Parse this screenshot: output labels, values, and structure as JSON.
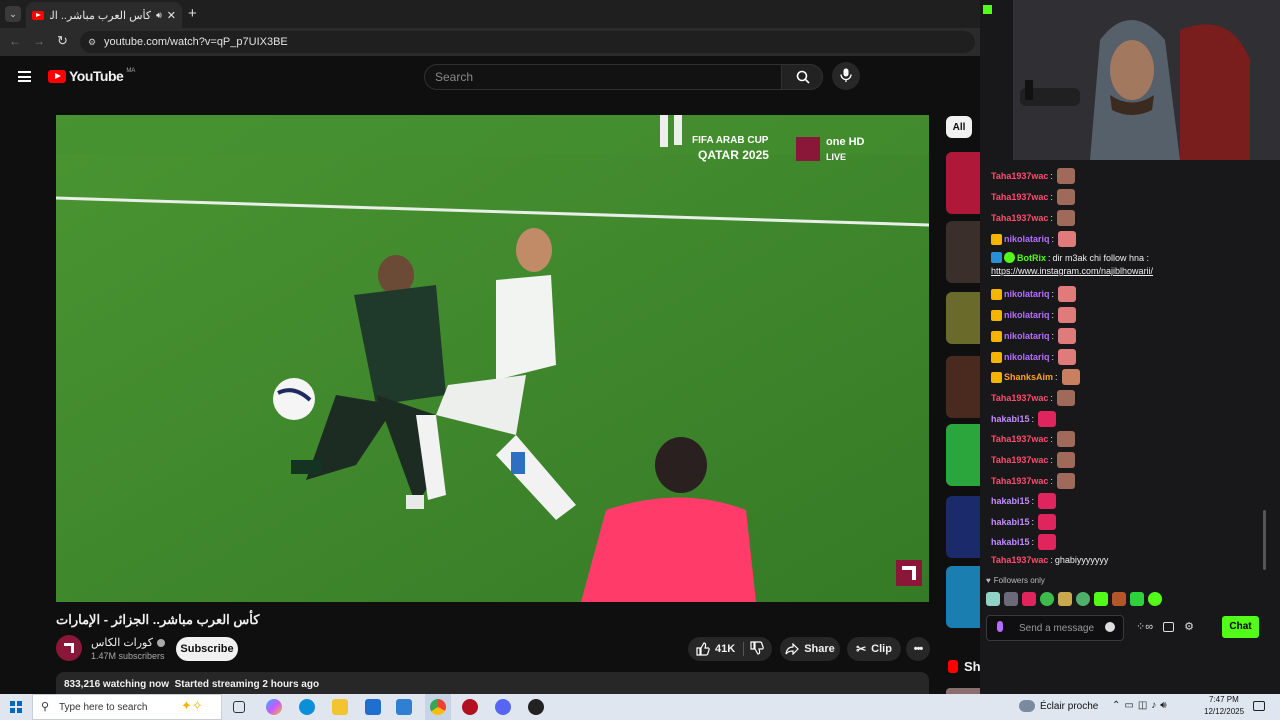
{
  "browser": {
    "tab_title": "كأس العرب مباشر.. الجزائر - الإ",
    "url": "youtube.com/watch?v=qP_p7UIX3BE"
  },
  "youtube": {
    "logo_text": "YouTube",
    "region": "MA",
    "search_placeholder": "Search",
    "overlay_event": "FIFA ARAB CUP",
    "overlay_event2": "QATAR 2025",
    "overlay_channel": "one HD",
    "overlay_live": "LIVE",
    "title": "كأس العرب مباشر.. الجزائر - الإمارات",
    "channel_name": "كورات الكاس",
    "subscribers": "1.47M subscribers",
    "subscribe_label": "Subscribe",
    "likes": "41K",
    "share_label": "Share",
    "clip_label": "Clip",
    "stats": "833,216 watching now  Started streaming 2 hours ago",
    "filter_chip": "All",
    "shorts_label": "Shorts"
  },
  "chat": {
    "messages": [
      {
        "user": "Taha1937wac",
        "text": "",
        "color": "#ff4b6e"
      },
      {
        "user": "Taha1937wac",
        "text": "",
        "color": "#ff4b6e"
      },
      {
        "user": "Taha1937wac",
        "text": "",
        "color": "#ff4b6e"
      },
      {
        "user": "nikolatariq",
        "text": "",
        "color": "#b76bff"
      },
      {
        "user": "BotRix",
        "text": "dir m3ak chi follow hna :",
        "color": "#53fc18"
      },
      {
        "user": "",
        "text": "https://www.instagram.com/najiblhowarii/",
        "color": "#ffffff"
      },
      {
        "user": "nikolatariq",
        "text": "",
        "color": "#b76bff"
      },
      {
        "user": "nikolatariq",
        "text": "",
        "color": "#b76bff"
      },
      {
        "user": "nikolatariq",
        "text": "",
        "color": "#b76bff"
      },
      {
        "user": "nikolatariq",
        "text": "",
        "color": "#b76bff"
      },
      {
        "user": "ShanksAim",
        "text": "",
        "color": "#ffa020"
      },
      {
        "user": "Taha1937wac",
        "text": "",
        "color": "#ff4b6e"
      },
      {
        "user": "hakabi15",
        "text": "",
        "color": "#c48bff"
      },
      {
        "user": "Taha1937wac",
        "text": "",
        "color": "#ff4b6e"
      },
      {
        "user": "Taha1937wac",
        "text": "",
        "color": "#ff4b6e"
      },
      {
        "user": "Taha1937wac",
        "text": "",
        "color": "#ff4b6e"
      },
      {
        "user": "hakabi15",
        "text": "",
        "color": "#c48bff"
      },
      {
        "user": "hakabi15",
        "text": "",
        "color": "#c48bff"
      },
      {
        "user": "hakabi15",
        "text": "",
        "color": "#c48bff"
      },
      {
        "user": "Taha1937wac",
        "text": "ghabiyyyyyyy",
        "color": "#ff4b6e"
      }
    ],
    "followers_only": "Followers only",
    "input_placeholder": "Send a message",
    "chat_button": "Chat"
  },
  "taskbar": {
    "search_placeholder": "Type here to search",
    "weather": "Éclair proche",
    "time": "7:47 PM",
    "date": "12/12/2025"
  },
  "colors": {
    "youtube_red": "#ff0000",
    "kick_green": "#53fc18",
    "pitch_green": "#3f8a2d"
  }
}
